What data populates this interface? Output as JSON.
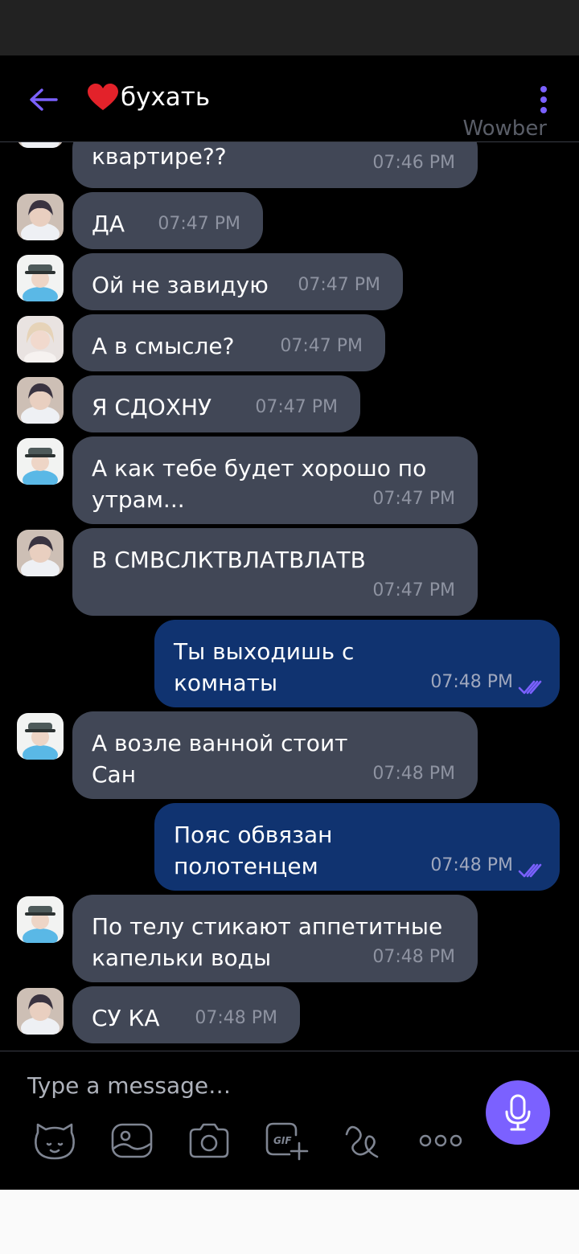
{
  "header": {
    "title": "бухать",
    "watermark": "Wowber"
  },
  "messages": [
    {
      "dir": "in",
      "text": "квартире??",
      "time": "07:46 PM",
      "avatar": "boy-dark"
    },
    {
      "dir": "in",
      "text": "ДА",
      "time": "07:47 PM",
      "avatar": "boy-dark"
    },
    {
      "dir": "in",
      "text": "Ой не завидую",
      "time": "07:47 PM",
      "avatar": "boy-cap"
    },
    {
      "dir": "in",
      "text": "А в смысле?",
      "time": "07:47 PM",
      "avatar": "girl-blonde"
    },
    {
      "dir": "in",
      "text": "Я СДОХНУ",
      "time": "07:47 PM",
      "avatar": "boy-dark"
    },
    {
      "dir": "in",
      "text": "А как тебе будет хорошо по\nутрам...",
      "time": "07:47 PM",
      "avatar": "boy-cap"
    },
    {
      "dir": "in",
      "text": "В СМВСЛКТВЛАТВЛАТВ",
      "time": "07:47 PM",
      "avatar": "boy-dark"
    },
    {
      "dir": "out",
      "text": "Ты выходишь с\nкомнаты",
      "time": "07:48 PM"
    },
    {
      "dir": "in",
      "text": "А возле ванной стоит\nСан",
      "time": "07:48 PM",
      "avatar": "boy-cap"
    },
    {
      "dir": "out",
      "text": "Пояс обвязан\nполотенцем",
      "time": "07:48 PM"
    },
    {
      "dir": "in",
      "text": "По телу стикают аппетитные\nкапельки воды",
      "time": "07:48 PM",
      "avatar": "boy-cap"
    },
    {
      "dir": "in",
      "text": "СУ КА",
      "time": "07:48 PM",
      "avatar": "boy-dark"
    }
  ],
  "composer": {
    "placeholder": "Type a message…",
    "toolbar_icons": [
      "sticker-bear-icon",
      "gallery-icon",
      "camera-icon",
      "gif-icon",
      "doodle-icon",
      "more-icon"
    ]
  },
  "colors": {
    "accent": "#7b61ff",
    "incoming_bubble": "#414756",
    "outgoing_bubble": "#103370",
    "background": "#000000"
  }
}
